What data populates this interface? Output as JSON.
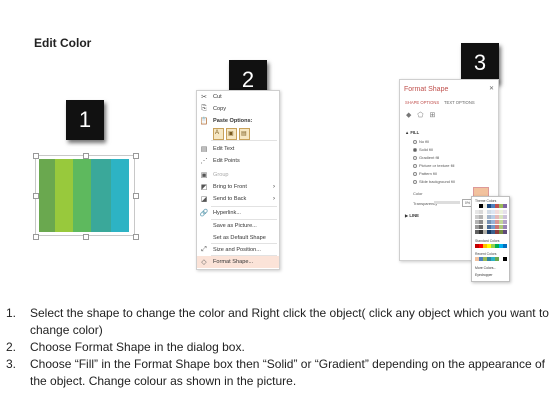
{
  "title": "Edit Color",
  "badges": [
    "1",
    "2",
    "3"
  ],
  "shape": {
    "stripe_colors": [
      "#6aa84f",
      "#98c93c",
      "#5eb95e",
      "#3aa89a",
      "#2db3c4"
    ]
  },
  "context_menu": {
    "items": [
      {
        "icon": "cut-icon",
        "glyph": "✂",
        "label": "Cut",
        "enabled": true
      },
      {
        "icon": "copy-icon",
        "glyph": "⎘",
        "label": "Copy",
        "enabled": true
      },
      {
        "icon": "paste-icon",
        "glyph": "📋",
        "label": "Paste Options:",
        "enabled": true,
        "header": true
      },
      {
        "icon": "edit-text-icon",
        "glyph": "▤",
        "label": "Edit Text",
        "enabled": true
      },
      {
        "icon": "edit-points-icon",
        "glyph": "⋰",
        "label": "Edit Points",
        "enabled": true
      },
      {
        "icon": "group-icon",
        "glyph": "▣",
        "label": "Group",
        "enabled": false
      },
      {
        "icon": "bring-front-icon",
        "glyph": "◩",
        "label": "Bring to Front",
        "enabled": true,
        "submenu": true
      },
      {
        "icon": "send-back-icon",
        "glyph": "◪",
        "label": "Send to Back",
        "enabled": true,
        "submenu": true
      },
      {
        "icon": "hyperlink-icon",
        "glyph": "🔗",
        "label": "Hyperlink...",
        "enabled": true
      },
      {
        "icon": "",
        "glyph": "",
        "label": "Save as Picture...",
        "enabled": true
      },
      {
        "icon": "",
        "glyph": "",
        "label": "Set as Default Shape",
        "enabled": true
      },
      {
        "icon": "size-position-icon",
        "glyph": "⤢",
        "label": "Size and Position...",
        "enabled": true
      },
      {
        "icon": "format-shape-icon",
        "glyph": "◇",
        "label": "Format Shape...",
        "enabled": true,
        "highlight": true
      }
    ]
  },
  "format_panel": {
    "title": "Format Shape",
    "close": "✕",
    "tabs": [
      "SHAPE OPTIONS",
      "TEXT OPTIONS"
    ],
    "fill_section": "FILL",
    "fill_options": [
      "No fill",
      "Solid fill",
      "Gradient fill",
      "Picture or texture fill",
      "Pattern fill",
      "Slide background fill"
    ],
    "fill_selected": 1,
    "color_label": "Color",
    "transparency_label": "Transparency",
    "transparency_value": "0%",
    "line_section": "LINE",
    "accent": "#c0504d"
  },
  "palette": {
    "theme_label": "Theme Colors",
    "standard_label": "Standard Colors",
    "recent_label": "Recent Colors",
    "more_colors": "More Colors...",
    "eyedropper": "Eyedropper",
    "theme_top": [
      "#ffffff",
      "#000000",
      "#eeece1",
      "#1f497d",
      "#4f81bd",
      "#c0504d",
      "#9bbb59",
      "#8064a2"
    ],
    "standard": [
      "#c00000",
      "#ff0000",
      "#ffc000",
      "#ffff00",
      "#92d050",
      "#00b050",
      "#00b0f0",
      "#0070c0"
    ],
    "recent": [
      "#f2c29e",
      "#4f81bd",
      "#9bbb59",
      "#31859c",
      "#2db3c4",
      "#6aa84f",
      "#ffffff",
      "#000000"
    ]
  },
  "instructions": [
    {
      "num": "1.",
      "text": "Select the shape to change the color and Right click the object( click any object which you want to change color)"
    },
    {
      "num": "2.",
      "text": "Choose Format Shape in the dialog box."
    },
    {
      "num": "3.",
      "text": "Choose “Fill” in the Format Shape box then “Solid” or “Gradient” depending on the appearance of the object. Change colour as shown in the picture."
    }
  ]
}
